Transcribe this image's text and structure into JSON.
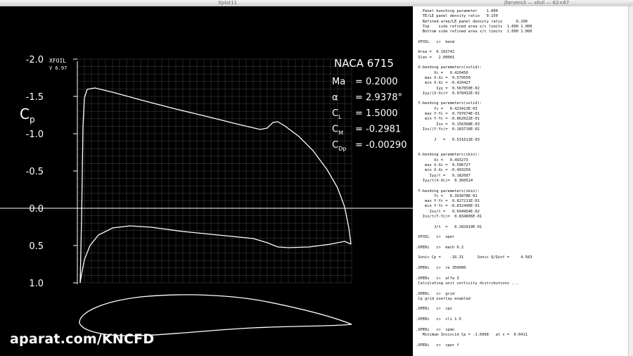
{
  "xplot": {
    "window_title": "Xplot11",
    "header": {
      "xfoil": "XFOIL",
      "version": "V 6.97"
    },
    "airfoil_name": "NACA 6715",
    "params": [
      {
        "label": "Ma",
        "value": "= 0.2000"
      },
      {
        "label": "α",
        "value": "= 2.9378°"
      },
      {
        "label": "C",
        "sub": "L",
        "value": "= 1.5000"
      },
      {
        "label": "C",
        "sub": "M",
        "value": "= -0.2981"
      },
      {
        "label": "C",
        "sub": "Dp",
        "value": "= -0.00290"
      }
    ],
    "y_axis_label": "C",
    "y_axis_label_sub": "p",
    "y_ticks": [
      "-2.0",
      "-1.5",
      "-1.0",
      "-0.5",
      "0.0",
      "0.5",
      "1.0"
    ],
    "y_tick_values": [
      -2.0,
      -1.5,
      -1.0,
      -0.5,
      0.0,
      0.5,
      1.0
    ]
  },
  "watermark": "aparat.com/KNCFD",
  "terminal": {
    "window_title": "jfarvers3 — xfoil — 82×67",
    "lines": [
      "   Panel bunching parameter    1.000",
      "   TE/LE panel density ratio   0.150",
      "   Refined-area/LE panel density ratio      0.200",
      "   Top    side refined area x/c limits  1.000 1.000",
      "   Bottom side refined area x/c limits  1.000 1.000",
      "",
      " XFOIL   c>  bend",
      "",
      " Area =  0.102742",
      " Slen =   2.00001",
      "",
      " X-bending parameters(solid):",
      "        Xc =   0.420450",
      "    max X-Xc =  0.579550",
      "    min X-Xc = -0.420427",
      "         Iyy =  0.567050E-02",
      "   Iyy/(X-Xc)=  0.978432E-02",
      "",
      " Y-bending parameters(solid):",
      "        Yc =   0.423413E-03",
      "    max Y-Yc =  0.797674E-01",
      "    min Y-Yc = -0.862022E-01",
      "         Ixx =  0.156368E-03",
      "   Ixx/(Y-Yc)=  0.183716E-02",
      "",
      "        J   =   0.531611E-03",
      "",
      "",
      " X-bending parameters(skin):",
      "        Xc =   0.493273",
      "    max X-Xc =  0.506727",
      "    min X-Xc = -0.493250",
      "      Iyy/t =   0.182687",
      "   Iyy/t(X-Xc)=  0.360524",
      "",
      " Y-bending parameters(skin):",
      "        Yc =   0.393878E-01",
      "    max Y-Yc =  0.827211E-01",
      "    min Y-Yc = -0.832496E-01",
      "      Ixx/t =   0.694964E-02",
      "   Ixx/t(Y-Yc)=  0.834806E-01",
      "",
      "        J/t  =   0.282919E-01",
      "",
      " XFOIL   c>  oper",
      "",
      ".OPERi   c>  mach 0.2",
      "",
      " Sonic Cp =    -16.31      Sonic Q/Qinf =     4.583",
      "",
      ".OPERi   c>  re 350000",
      "",
      ".OPERv   c>  alfa 3",
      " Calculating unit vorticity distributions ...",
      "",
      ".OPERi   c>  grid",
      " Cp grid overlay enabled",
      "",
      ".OPERi   c>  cpx",
      "",
      ".OPERi   c>  cli 1.5",
      "",
      ".OPERi   c>  cpmn",
      "   Minimum Inviscid Cp = -1.6068   at x =  0.0411",
      "",
      ".OPERi   c>  cpwr f"
    ]
  }
}
